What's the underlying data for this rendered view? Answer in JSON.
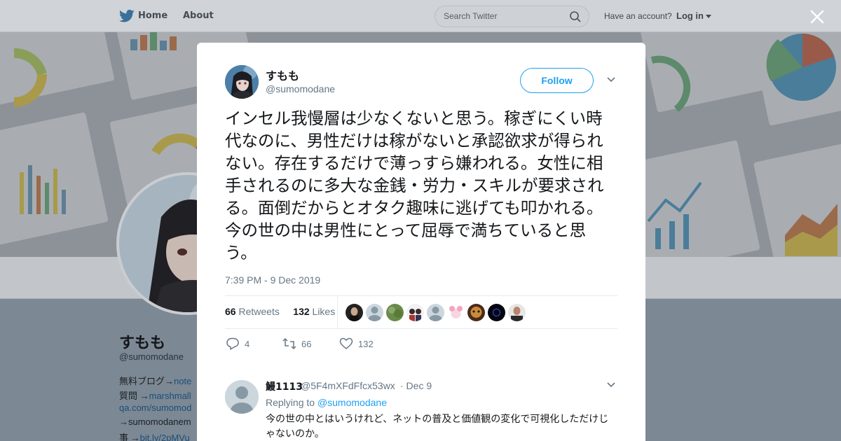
{
  "nav": {
    "home_label": "Home",
    "about_label": "About",
    "search_placeholder": "Search Twitter",
    "have_account": "Have an account?",
    "login_label": "Log in"
  },
  "profile": {
    "name": "すもも",
    "handle": "@sumomodane",
    "bio": [
      {
        "text": "無料ブログ→",
        "link": "note"
      },
      {
        "text": "質問 →",
        "link": "marshmall"
      },
      {
        "text": "",
        "link": "qa.com/sumomod"
      },
      {
        "text": "→sumomodanem",
        "link": ""
      },
      {
        "text": "事 →",
        "link": "bit.ly/2pMVu"
      }
    ]
  },
  "tweet": {
    "name": "すもも",
    "handle": "@sumomodane",
    "follow_label": "Follow",
    "text": "インセル我慢層は少なくないと思う。稼ぎにくい時代なのに、男性だけは稼がないと承認欲求が得られない。存在するだけで薄っすら嫌われる。女性に相手されるのに多大な金銭・労力・スキルが要求される。面倒だからとオタク趣味に逃げても叩かれる。今の世の中は男性にとって屈辱で満ちていると思う。",
    "time": "7:39 PM - 9 Dec 2019",
    "retweets_count": "66",
    "retweets_label": "Retweets",
    "likes_count": "132",
    "likes_label": "Likes",
    "replies": "4",
    "retweets": "66",
    "likes": "132"
  },
  "reply": {
    "name": "鰻1113",
    "handle": "@5F4mXFdFfcx53wx",
    "date": "· Dec 9",
    "replying_prefix": "Replying to",
    "replying_to": "@sumomodane",
    "text": "今の世の中とはいうけれど、ネットの普及と価値観の変化で可視化しただけじゃないのか。"
  },
  "colors": {
    "accent": "#1da1f2",
    "muted": "#657786",
    "text": "#14171a"
  }
}
